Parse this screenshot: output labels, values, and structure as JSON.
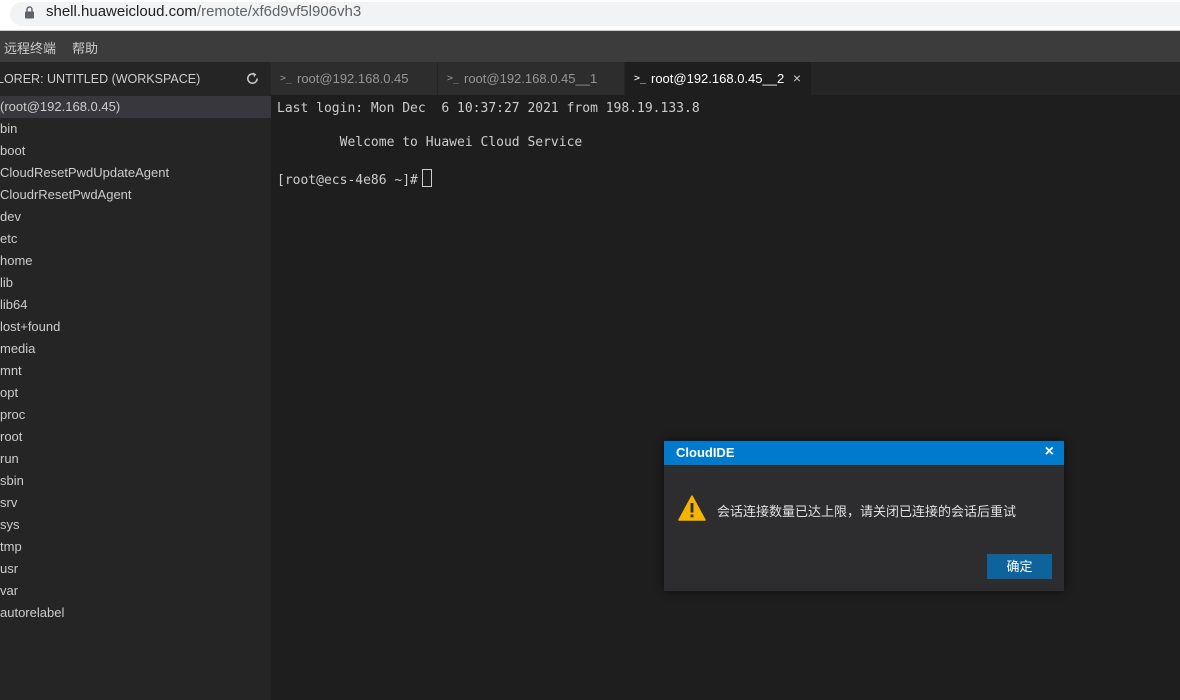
{
  "browser": {
    "url_host": "shell.huaweicloud.com",
    "url_path": "/remote/xf6d9vf5l906vh3"
  },
  "menubar": {
    "items": [
      "远程终端",
      "帮助"
    ]
  },
  "explorer": {
    "title": "LORER: UNTITLED (WORKSPACE)",
    "root": "(root@192.168.0.45)",
    "items": [
      "bin",
      "boot",
      "CloudResetPwdUpdateAgent",
      "CloudrResetPwdAgent",
      "dev",
      "etc",
      "home",
      "lib",
      "lib64",
      "lost+found",
      "media",
      "mnt",
      "opt",
      "proc",
      "root",
      "run",
      "sbin",
      "srv",
      "sys",
      "tmp",
      "usr",
      "var",
      "autorelabel"
    ]
  },
  "tabs": [
    {
      "icon": ">_",
      "label": "root@192.168.0.45"
    },
    {
      "icon": ">_",
      "label": "root@192.168.0.45__1"
    },
    {
      "icon": ">_",
      "label": "root@192.168.0.45__2",
      "close": "×"
    }
  ],
  "terminal": {
    "line1": "Last login: Mon Dec  6 10:37:27 2021 from 198.19.133.8",
    "line2": "        Welcome to Huawei Cloud Service",
    "prompt": "[root@ecs-4e86 ~]#"
  },
  "dialog": {
    "title": "CloudIDE",
    "close": "×",
    "message": "会话连接数量已达上限，请关闭已连接的会话后重试",
    "ok_label": "确定"
  },
  "colors": {
    "accent": "#007acc",
    "button": "#0e639c",
    "warning": "#f4b400"
  }
}
